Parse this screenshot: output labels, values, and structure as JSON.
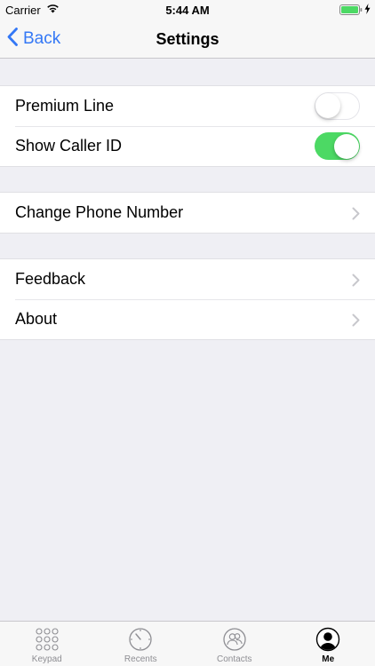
{
  "status_bar": {
    "carrier": "Carrier",
    "time": "5:44 AM",
    "battery_color": "#4cd964"
  },
  "nav": {
    "back_label": "Back",
    "title": "Settings",
    "accent": "#3478f6"
  },
  "groups": [
    {
      "rows": [
        {
          "label": "Premium Line",
          "control": "toggle",
          "on": false
        },
        {
          "label": "Show Caller ID",
          "control": "toggle",
          "on": true
        }
      ]
    },
    {
      "rows": [
        {
          "label": "Change Phone Number",
          "control": "chevron-right-icon"
        }
      ]
    },
    {
      "rows": [
        {
          "label": "Feedback",
          "control": "chevron-right-icon"
        },
        {
          "label": "About",
          "control": "chevron-right-icon"
        }
      ]
    }
  ],
  "tab_bar": {
    "tabs": [
      {
        "label": "Keypad",
        "icon": "keypad-icon",
        "active": false
      },
      {
        "label": "Recents",
        "icon": "recents-icon",
        "active": false
      },
      {
        "label": "Contacts",
        "icon": "contacts-icon",
        "active": false
      },
      {
        "label": "Me",
        "icon": "person-icon",
        "active": true
      }
    ]
  }
}
